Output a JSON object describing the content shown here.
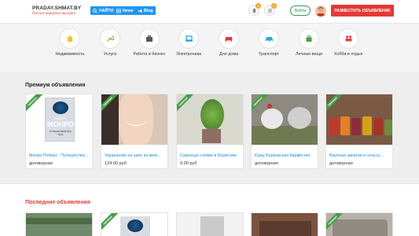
{
  "header": {
    "logo_title": "PRADAY.SHMAT.BY",
    "logo_sub": "быстро недорого выгодно",
    "buttons": [
      {
        "label": "НАЙТИ",
        "icon": "search-icon"
      },
      {
        "label": "News",
        "icon": "news-icon"
      },
      {
        "label": "Blog",
        "icon": "megaphone-icon"
      }
    ],
    "bell_badge": "0",
    "list_badge": "0",
    "login_label": "Войти",
    "post_label": "РАЗМЕСТИТЬ ОБЪЯВЛЕНИЕ",
    "accent": "#2196f3",
    "red": "#e53935"
  },
  "categories": [
    {
      "label": "Недвижимость",
      "icon": "house-icon",
      "color": "#f6c026"
    },
    {
      "label": "Услуги",
      "icon": "wrench-icon",
      "color": "#8bc34a"
    },
    {
      "label": "Работа и бизнес",
      "icon": "briefcase-icon",
      "color": "#555555"
    },
    {
      "label": "Электроника",
      "icon": "laptop-icon",
      "color": "#2196f3"
    },
    {
      "label": "Для дома",
      "icon": "sofa-icon",
      "color": "#e53935"
    },
    {
      "label": "Транспорт",
      "icon": "car-icon",
      "color": "#29a8e0"
    },
    {
      "label": "Личные вещи",
      "icon": "bag-icon",
      "color": "#43a047"
    },
    {
      "label": "Хобби и отдых",
      "icon": "people-icon",
      "color": "#e53935"
    }
  ],
  "premium": {
    "title": "Премиум объявления",
    "ribbon": "премиум",
    "cards": [
      {
        "title": "Монро Роберт . Путешестви...",
        "price": "договорная"
      },
      {
        "title": "Украшение на шею из жем...",
        "price": "124.00 руб"
      },
      {
        "title": "Саженцы стевии в Борисове",
        "price": "9.00 руб"
      },
      {
        "title": "Куры Борковская барвистая",
        "price": "договорная"
      },
      {
        "title": "Вкусные закатки и сельск...",
        "price": "договорная"
      }
    ],
    "book": {
      "author_1": "РОБЕРТ",
      "author_2": "МОНРО",
      "subtitle": "ПУТЕШЕСТВИЯ ВНЕ ТЕЛА"
    }
  },
  "latest": {
    "title": "Последние объявления"
  }
}
